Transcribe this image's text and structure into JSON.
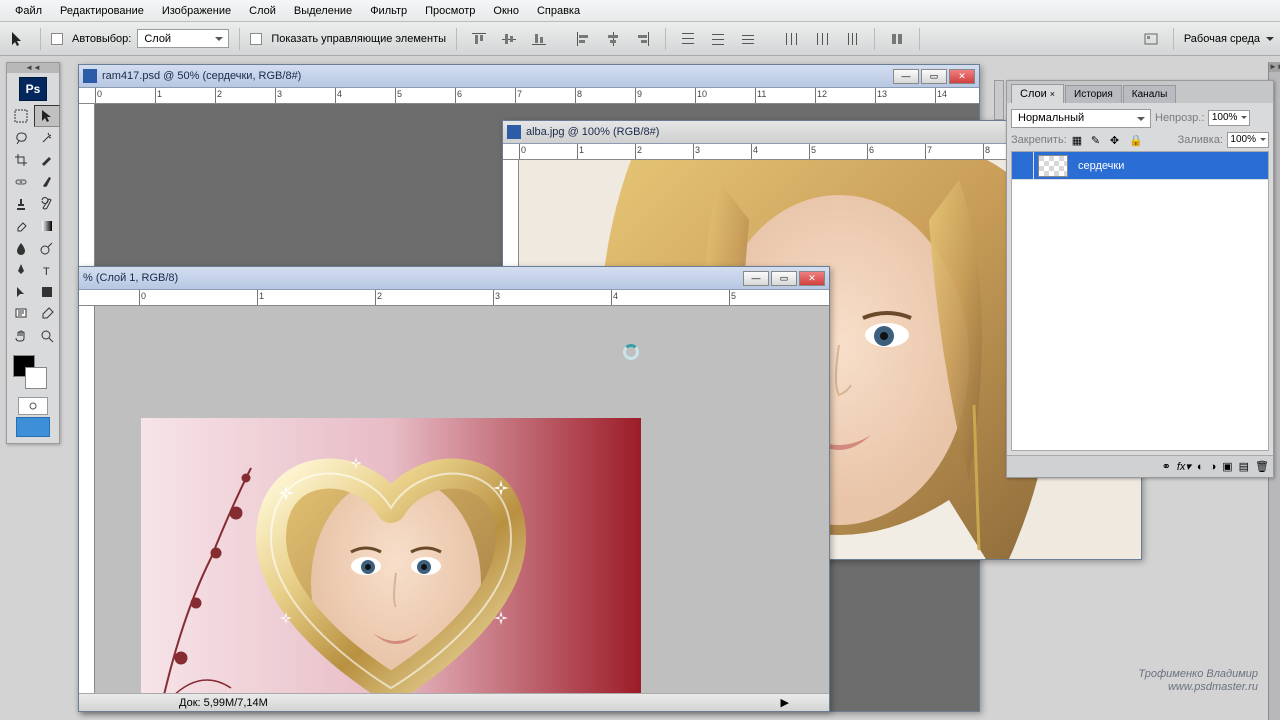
{
  "menu": {
    "items": [
      "Файл",
      "Редактирование",
      "Изображение",
      "Слой",
      "Выделение",
      "Фильтр",
      "Просмотр",
      "Окно",
      "Справка"
    ]
  },
  "options": {
    "autoselect_label": "Автовыбор:",
    "autoselect_value": "Слой",
    "show_controls": "Показать управляющие элементы",
    "workspace": "Рабочая среда"
  },
  "docs": {
    "doc1": {
      "title": "ram417.psd @ 50% (сердечки, RGB/8#)"
    },
    "doc2": {
      "title": "alba.jpg @ 100% (RGB/8#)"
    },
    "doc3": {
      "title": "% (Слой 1, RGB/8)"
    }
  },
  "panels": {
    "tabs": [
      "Слои",
      "История",
      "Каналы"
    ],
    "blend_mode": "Нормальный",
    "opacity_label": "Непрозр.:",
    "opacity_value": "100%",
    "lock_label": "Закрепить:",
    "fill_label": "Заливка:",
    "fill_value": "100%",
    "layer_name": "сердечки"
  },
  "status": {
    "doc_size": "Док: 5,99M/7,14M"
  },
  "watermark": {
    "line1": "Трофименко Владимир",
    "line2": "www.psdmaster.ru"
  }
}
